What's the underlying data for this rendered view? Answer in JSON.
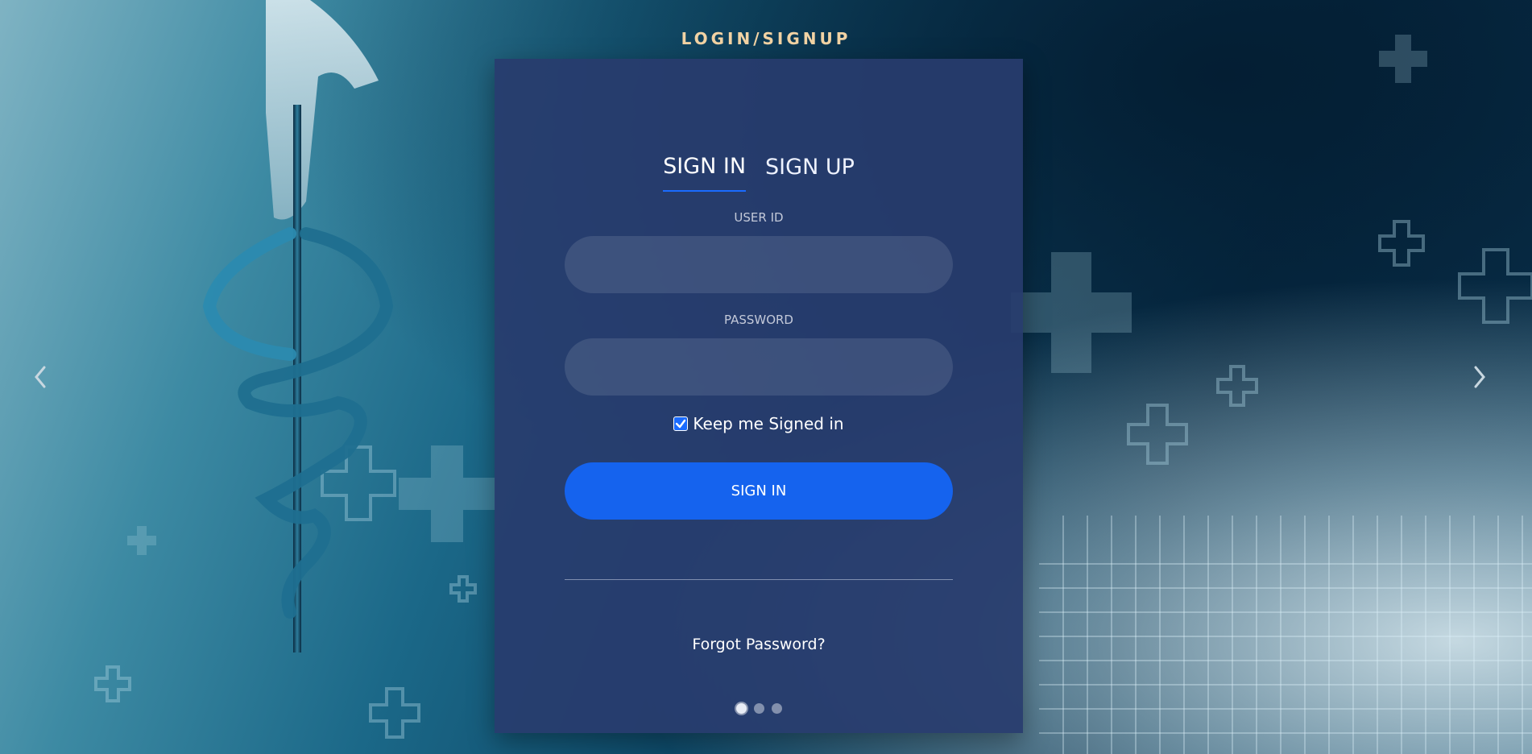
{
  "header": {
    "title": "LOGIN/SIGNUP"
  },
  "tabs": [
    {
      "label": "SIGN IN",
      "active": true
    },
    {
      "label": "SIGN UP",
      "active": false
    }
  ],
  "form": {
    "user_id_label": "USER ID",
    "user_id_value": "",
    "password_label": "PASSWORD",
    "password_value": "",
    "remember_label": "Keep me Signed in",
    "remember_checked": true,
    "submit_label": "SIGN IN",
    "forgot_label": "Forgot Password?"
  },
  "carousel": {
    "slide_count": 3,
    "active_index": 0,
    "prev_icon": "chevron-left-icon",
    "next_icon": "chevron-right-icon"
  },
  "colors": {
    "accent": "#1563ee",
    "card": "#2b3c6e",
    "title": "#f2d3a4"
  }
}
